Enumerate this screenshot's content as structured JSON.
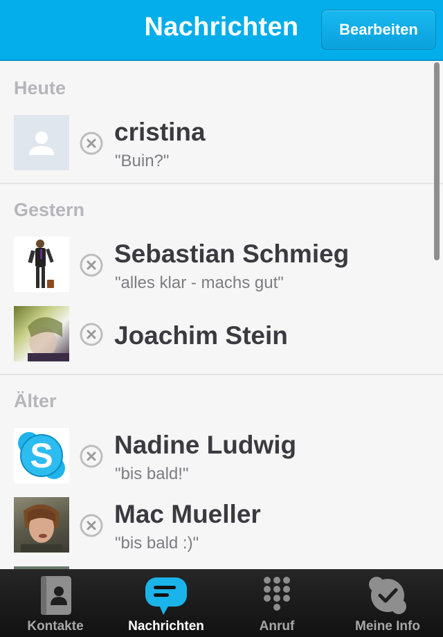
{
  "header": {
    "title": "Nachrichten",
    "edit_label": "Bearbeiten"
  },
  "sections": [
    {
      "title": "Heute"
    },
    {
      "title": "Gestern"
    },
    {
      "title": "Älter"
    }
  ],
  "conversations": [
    {
      "name": "cristina",
      "message": "\"Buin?\"",
      "avatar": "default-avatar-icon"
    },
    {
      "name": "Sebastian Schmieg",
      "message": "\"alles klar - machs gut\"",
      "avatar": "photo"
    },
    {
      "name": "Joachim Stein",
      "message": "",
      "avatar": "photo"
    },
    {
      "name": "Nadine Ludwig",
      "message": "\"bis bald!\"",
      "avatar": "skype-logo"
    },
    {
      "name": "Mac Mueller",
      "message": "\"bis bald :)\"",
      "avatar": "photo"
    }
  ],
  "tabs": [
    {
      "label": "Kontakte",
      "icon": "contacts-icon",
      "active": false
    },
    {
      "label": "Nachrichten",
      "icon": "chat-bubble-icon",
      "active": true
    },
    {
      "label": "Anruf",
      "icon": "dialpad-icon",
      "active": false
    },
    {
      "label": "Meine Info",
      "icon": "profile-check-icon",
      "active": false
    }
  ],
  "colors": {
    "header": "#03aeea",
    "active_tab_icon": "#1ab3ea",
    "background": "#f6f6f6"
  }
}
